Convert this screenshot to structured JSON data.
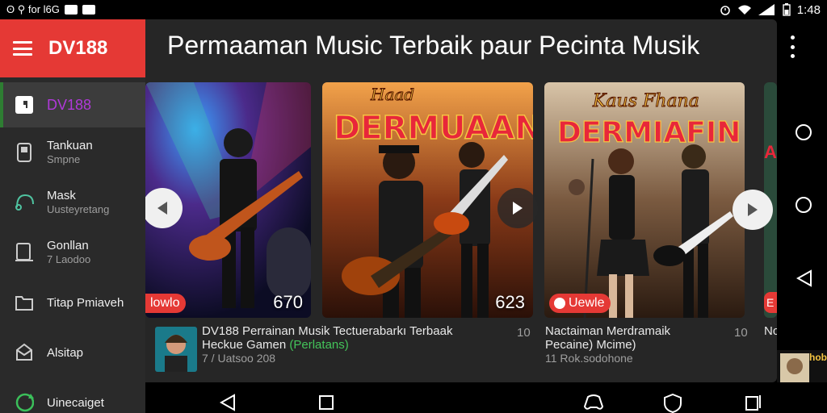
{
  "status_bar": {
    "left_text": "ʘ ⚲ for l6G",
    "time": "1:48",
    "icons": [
      "alarm-icon",
      "wifi-icon",
      "signal-icon",
      "battery-icon"
    ]
  },
  "sidebar": {
    "brand": "DV188",
    "items": [
      {
        "label": "DV188",
        "sub": "",
        "icon": "app-icon",
        "active": true
      },
      {
        "label": "Tankuan",
        "sub": "Smpne",
        "icon": "phone-icon"
      },
      {
        "label": "Mask",
        "sub": "Uusteyretang",
        "icon": "headphones-icon"
      },
      {
        "label": "Gonllan",
        "sub": "7 Laodoo",
        "icon": "device-icon"
      },
      {
        "label": "Titap Pmiaveh",
        "sub": "",
        "icon": "folder-icon"
      },
      {
        "label": "Alsitap",
        "sub": "",
        "icon": "envelope-icon"
      },
      {
        "label": "Uinecaiget",
        "sub": "",
        "icon": "refresh-icon"
      }
    ]
  },
  "main": {
    "title": "Permaaman Music Terbaik paur Pecinta Musik",
    "cards": [
      {
        "count": "670",
        "chip": "lowlo"
      },
      {
        "banner": "Haad DERMUAAN",
        "count": "623"
      },
      {
        "banner": "Kaus Fhana DERMIAFIN",
        "chip": "Uewle"
      },
      {
        "chip": "E",
        "partial_text": "A"
      }
    ],
    "info": [
      {
        "title": "DV188 Perrainan Musik Tectuerabarkı Terbaak",
        "sub_prefix": "Heckue Gamen ",
        "sub_highlight": "(Perlatans)",
        "meta": "7 / Uatsoo 208",
        "number": "10"
      },
      {
        "title": "Nactaiman Merdramaik",
        "sub_prefix": "Pecaine) Mcime)",
        "sub_highlight": "",
        "meta": "11 Rok.sodohone",
        "number": "10"
      },
      {
        "title": "No",
        "sub_prefix": "",
        "sub_highlight": "",
        "meta": "",
        "number": ""
      }
    ]
  },
  "thumb_right_label": "hob",
  "colors": {
    "accent_red": "#e53935",
    "active_purple": "#b039d9",
    "highlight_green": "#43c45a",
    "panel_bg": "#262626",
    "sidebar_bg": "#2a2a2a"
  }
}
